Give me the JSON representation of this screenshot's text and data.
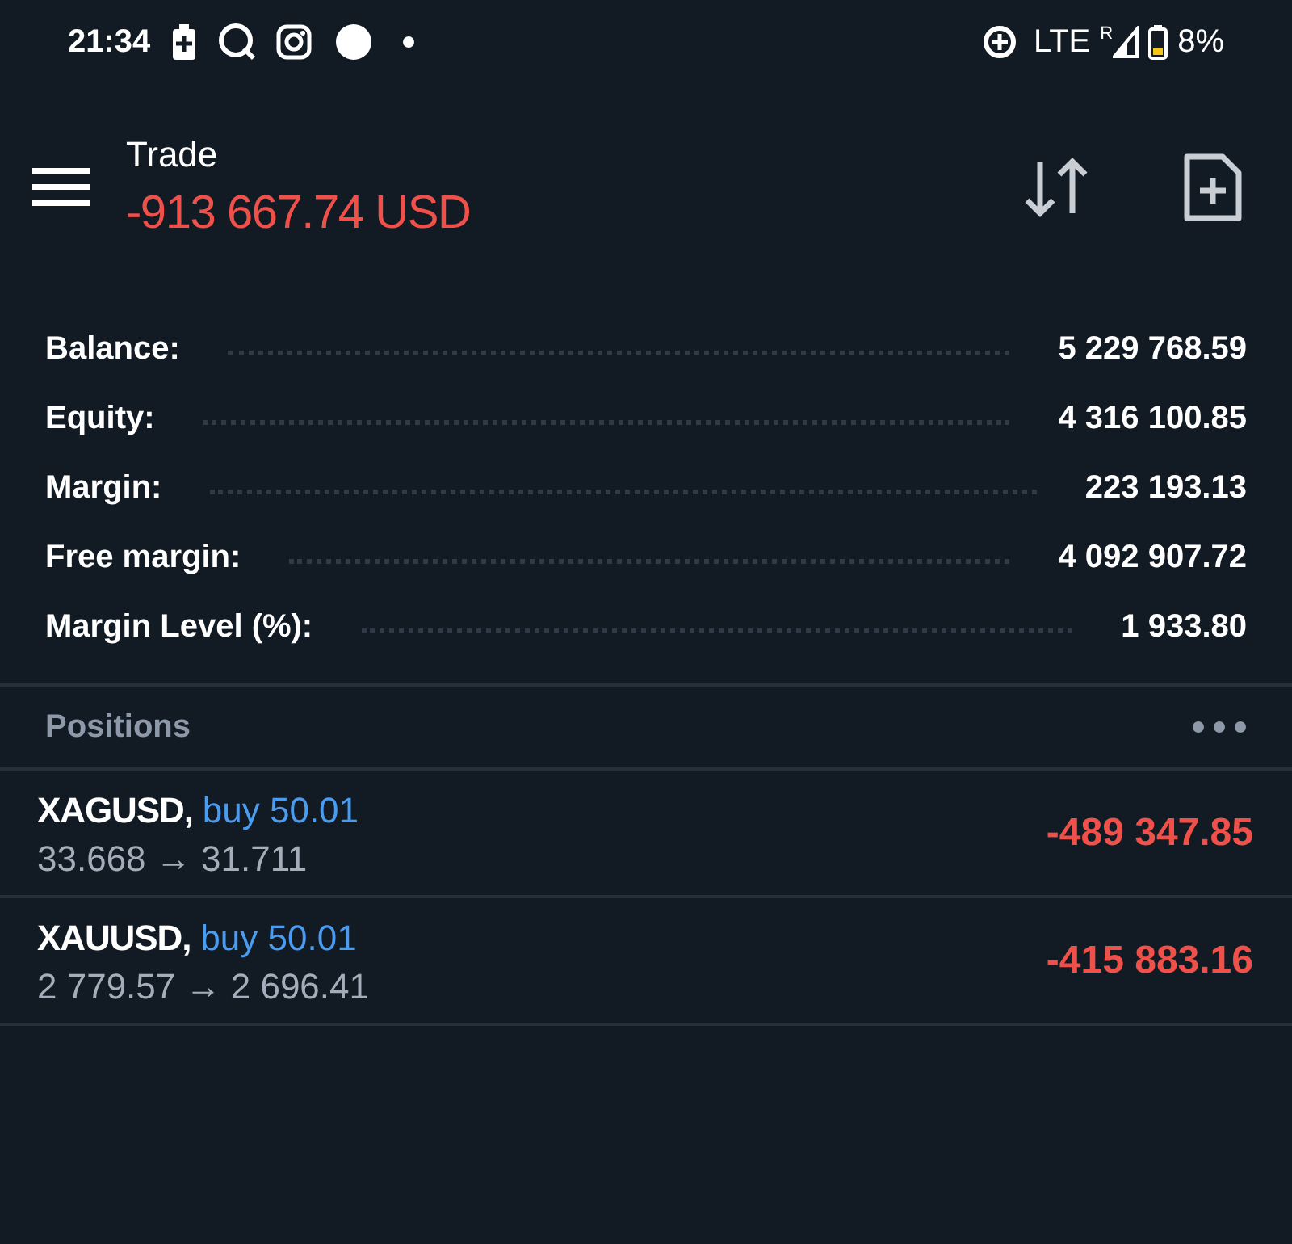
{
  "status_bar": {
    "time": "21:34",
    "network": "LTE",
    "roaming": "R",
    "battery": "8%"
  },
  "header": {
    "title": "Trade",
    "profit": "-913 667.74 USD"
  },
  "summary": [
    {
      "label": "Balance:",
      "value": "5 229 768.59"
    },
    {
      "label": "Equity:",
      "value": "4 316 100.85"
    },
    {
      "label": "Margin:",
      "value": "223 193.13"
    },
    {
      "label": "Free margin:",
      "value": "4 092 907.72"
    },
    {
      "label": "Margin Level (%):",
      "value": "1 933.80"
    }
  ],
  "positions": {
    "title": "Positions",
    "items": [
      {
        "symbol": "XAGUSD,",
        "side": "buy 50.01",
        "prices": "33.668 → 31.711",
        "profit": "-489 347.85"
      },
      {
        "symbol": "XAUUSD,",
        "side": "buy 50.01",
        "prices": "2 779.57 → 2 696.41",
        "profit": "-415 883.16"
      }
    ]
  }
}
